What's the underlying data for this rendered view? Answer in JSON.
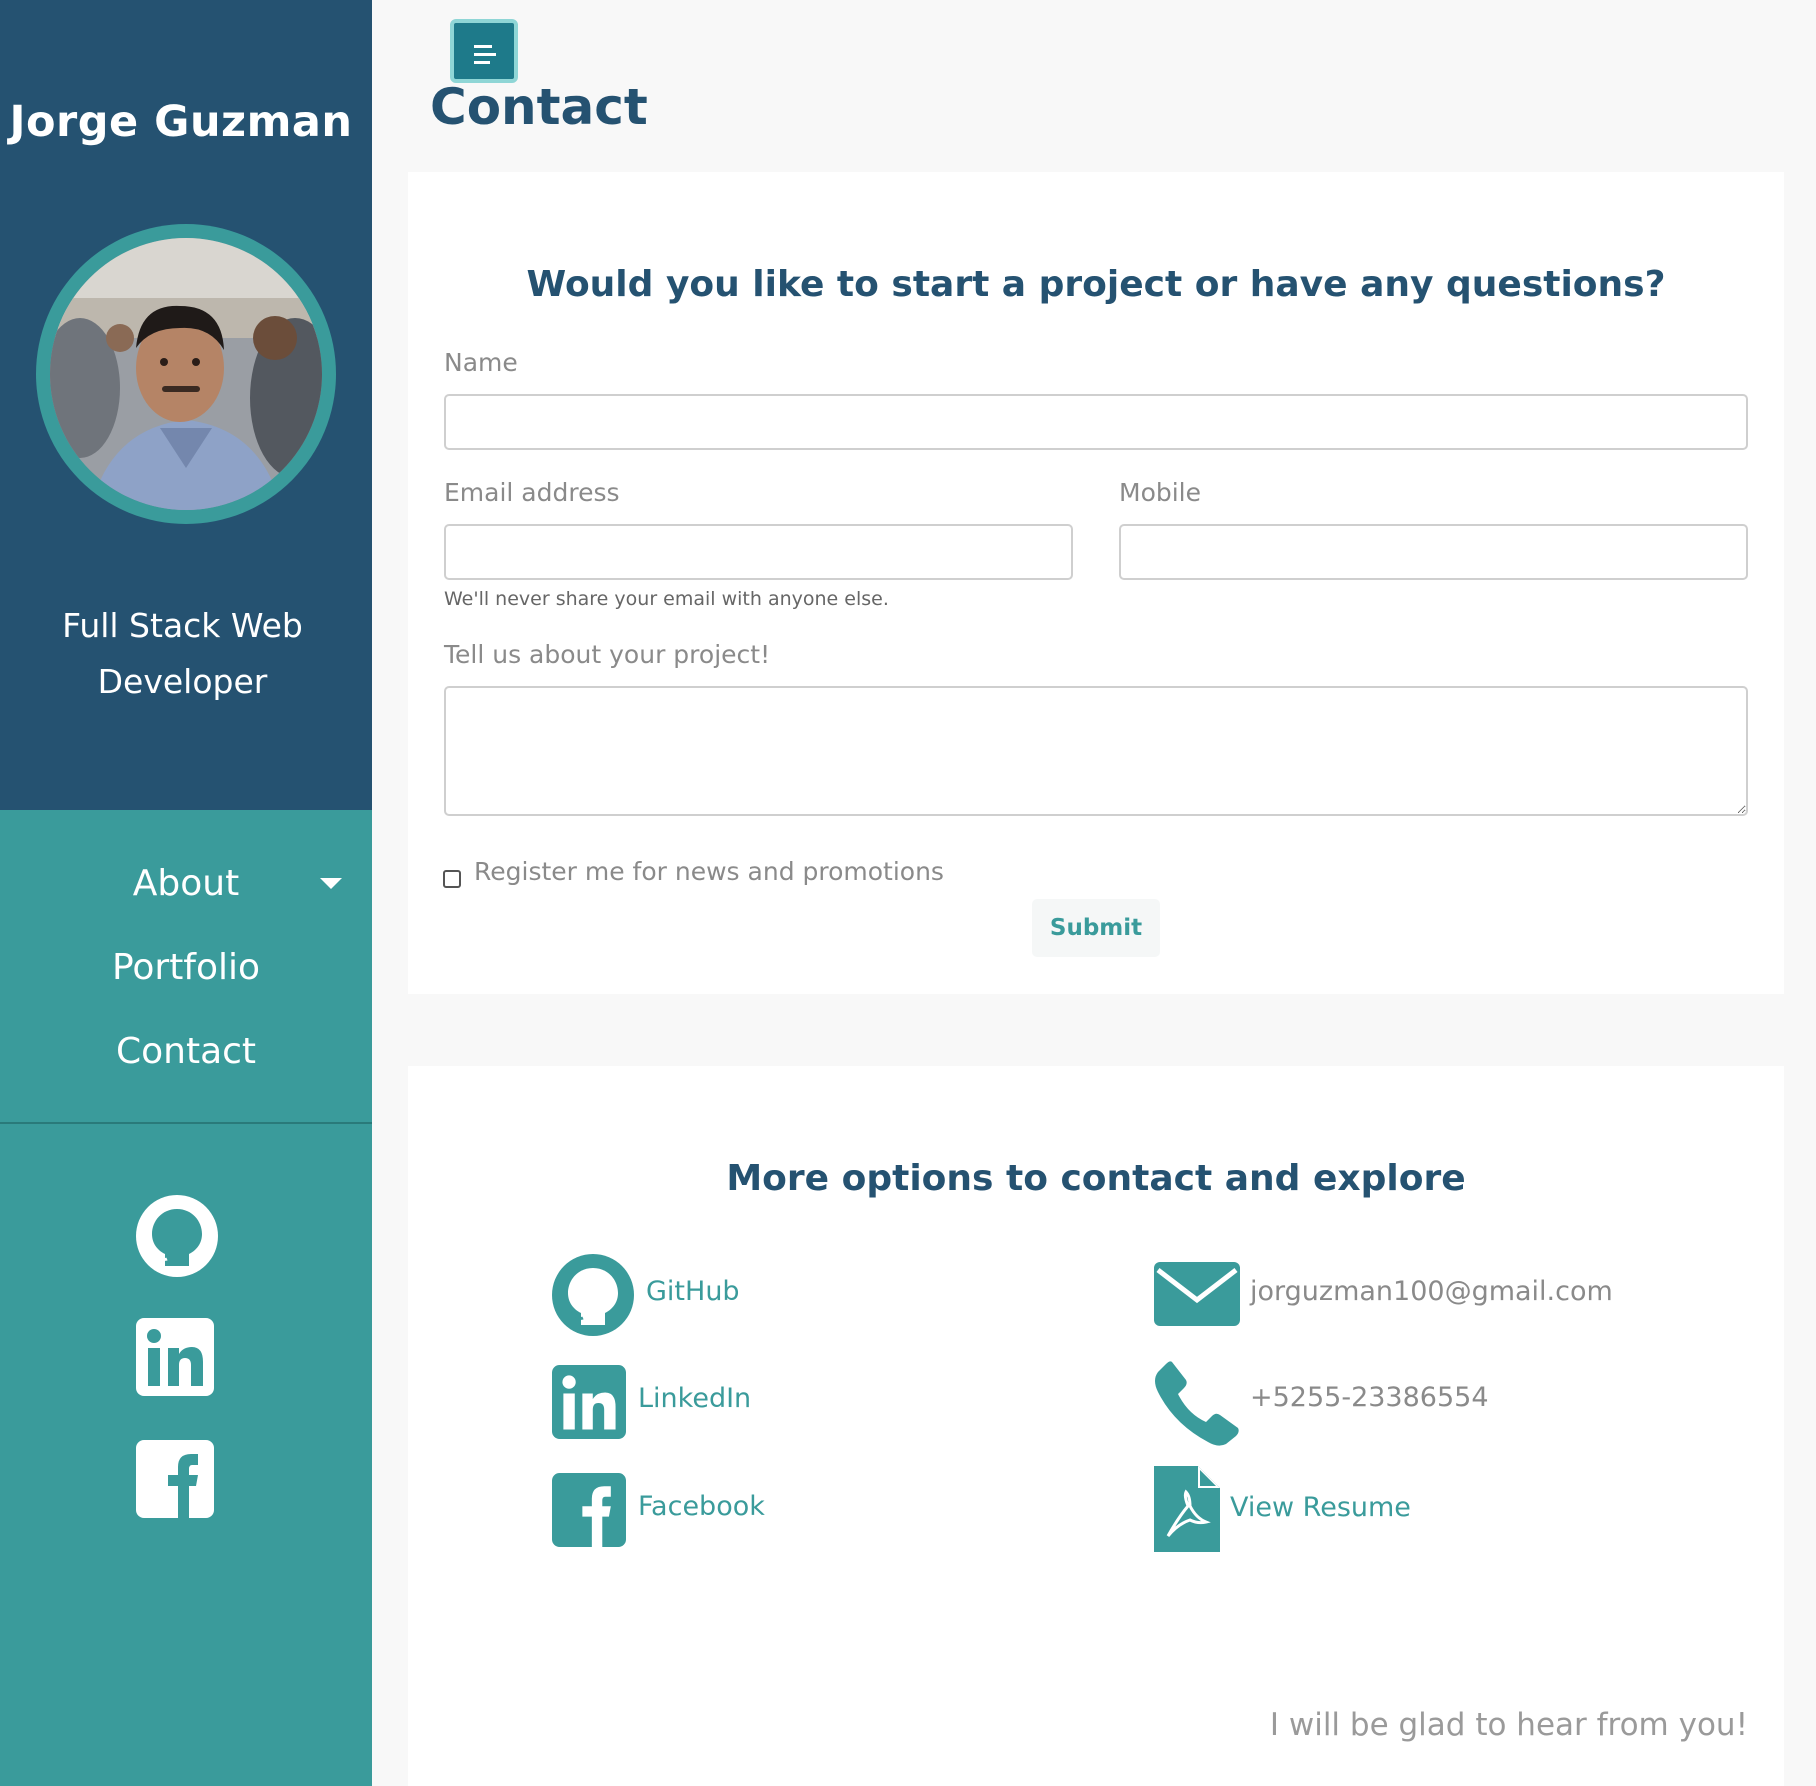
{
  "sidebar": {
    "brand": "Jorge Guzman",
    "job_title_line1": "Full Stack Web",
    "job_title_line2": "Developer",
    "nav": [
      {
        "label": "About"
      },
      {
        "label": "Portfolio"
      },
      {
        "label": "Contact"
      }
    ],
    "social_icons": [
      "github-icon",
      "linkedin-icon",
      "facebook-icon"
    ]
  },
  "header": {
    "title": "Contact"
  },
  "form": {
    "heading": "Would you like to start a project or have any questions?",
    "name_label": "Name",
    "name_value": "",
    "email_label": "Email address",
    "email_value": "",
    "email_help": "We'll never share your email with anyone else.",
    "mobile_label": "Mobile",
    "mobile_value": "",
    "project_label": "Tell us about your project!",
    "project_value": "",
    "newsletter_label": "Register me for news and promotions",
    "newsletter_checked": false,
    "submit_label": "Submit"
  },
  "more": {
    "heading": "More options to contact and explore",
    "github": "GitHub",
    "linkedin": "LinkedIn",
    "facebook": "Facebook",
    "email": "jorguzman100@gmail.com",
    "phone": "+5255-23386554",
    "resume": "View Resume",
    "footer_note": "I will be glad to hear from you!"
  },
  "colors": {
    "sidebar_top": "#255271",
    "sidebar_accent": "#3a9b9b",
    "heading": "#255271",
    "link": "#3a9b9b"
  }
}
